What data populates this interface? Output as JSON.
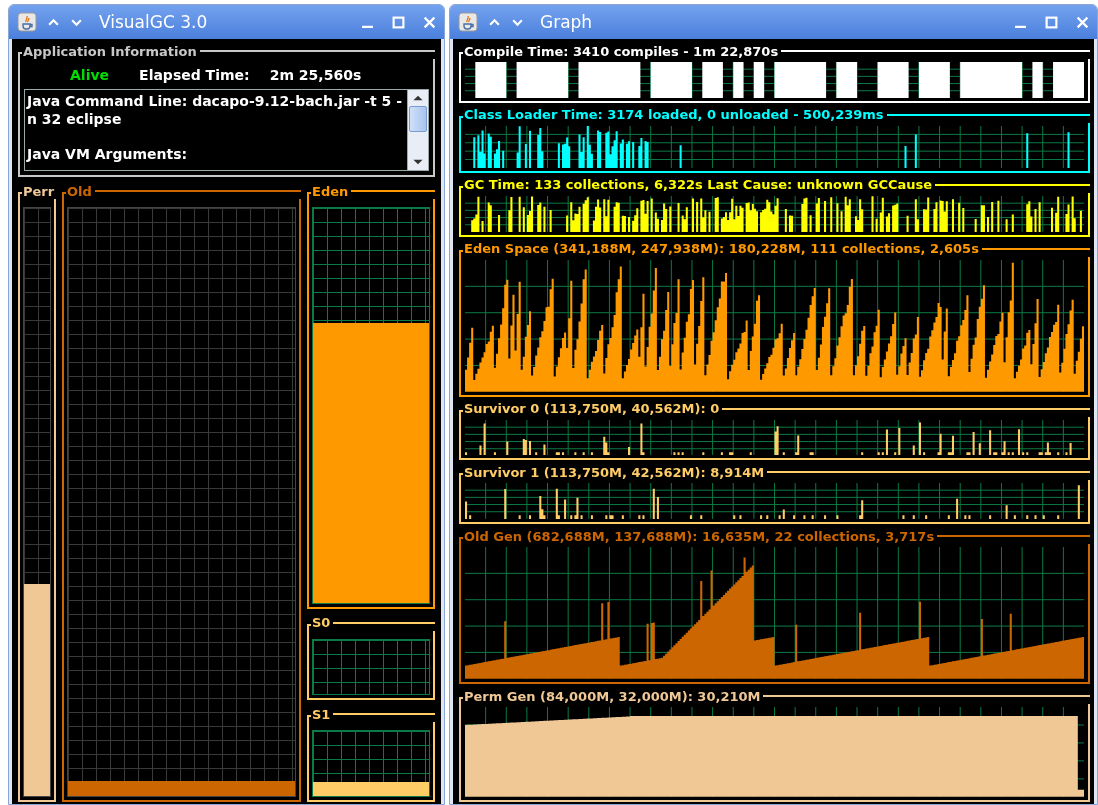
{
  "left_window": {
    "title": "VisualGC 3.0",
    "app_info": {
      "heading": "Application Information",
      "status": "Alive",
      "elapsed_label": "Elapsed Time:",
      "elapsed_value": "2m 25,560s",
      "details": [
        "Java Command Line: dacapo-9.12-bach.jar -t 5 -n 32 eclipse",
        "Java VM Arguments:"
      ]
    },
    "spaces": [
      {
        "label": "Perr",
        "color": "#f0c896",
        "level": 0.36
      },
      {
        "label": "Old",
        "color": "#cc6600",
        "level": 0.025
      },
      {
        "label": "Eden",
        "color": "#ff9900",
        "level": 0.71
      },
      {
        "label": "S0",
        "color": "#ffcc66"
      },
      {
        "label": "S1",
        "color": "#ffcc66",
        "kind": "residue"
      }
    ]
  },
  "right_window": {
    "title": "Graph",
    "graphs": [
      {
        "title": "Compile Time: 3410 compiles - 1m 22,870s",
        "color": "#ffffff",
        "kind": "blocks"
      },
      {
        "title": "Class Loader Time: 3174 loaded, 0 unloaded - 500,239ms",
        "color": "#00ffff",
        "kind": "sparse-spikes"
      },
      {
        "title": "GC Time: 133 collections, 6,322s  Last Cause: unknown GCCause",
        "color": "#ffff00",
        "kind": "spikes"
      },
      {
        "title": "Eden Space (341,188M, 247,938M): 180,228M, 111 collections, 2,605s",
        "color": "#ff9900",
        "kind": "sawtooth"
      },
      {
        "title": "Survivor 0 (113,750M, 40,562M): 0",
        "color": "#ffcc66",
        "kind": "bursts"
      },
      {
        "title": "Survivor 1 (113,750M, 42,562M): 8,914M",
        "color": "#ffcc66",
        "kind": "bursts"
      },
      {
        "title": "Old Gen (682,688M, 137,688M): 16,635M, 22 collections, 3,717s",
        "color": "#cc6600",
        "kind": "growth"
      },
      {
        "title": "Perm Gen (84,000M, 32,000M): 30,210M",
        "color": "#f0c896",
        "kind": "flat"
      }
    ]
  }
}
